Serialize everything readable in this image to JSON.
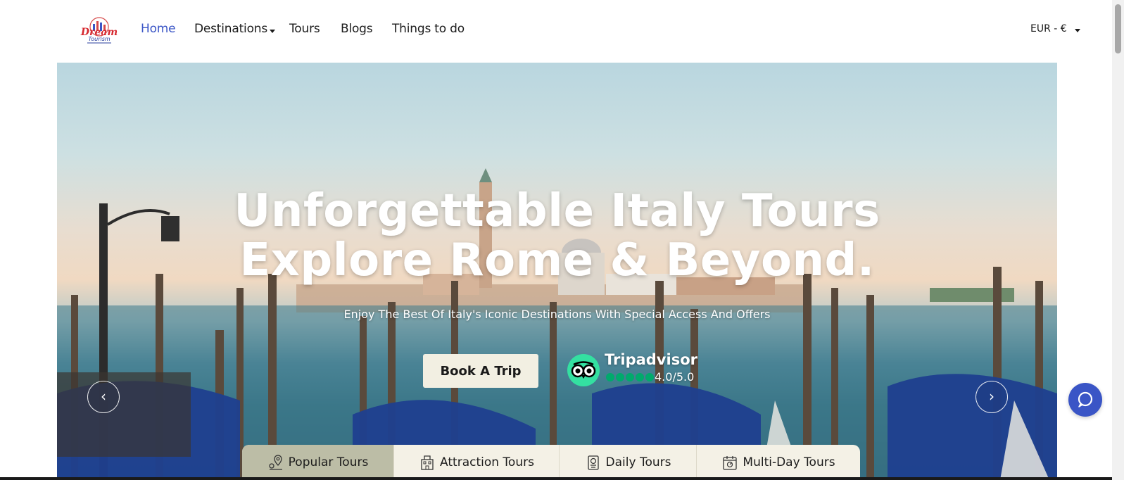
{
  "nav": {
    "logo_text": "Dream Tourism",
    "links": [
      {
        "label": "Home",
        "active": true
      },
      {
        "label": "Destinations",
        "has_dropdown": true
      },
      {
        "label": "Tours"
      },
      {
        "label": "Blogs"
      },
      {
        "label": "Things to do"
      }
    ],
    "currency": "EUR - €",
    "active_color": "#3a55c6"
  },
  "hero": {
    "headline_line1": "Unforgettable Italy Tours",
    "headline_line2": "Explore Rome & Beyond.",
    "subheadline": "Enjoy The Best Of Italy's Iconic Destinations With Special Access And Offers",
    "cta_label": "Book A Trip",
    "tripadvisor": {
      "name": "Tripadvisor",
      "rating_text": "4.0/5.0",
      "rating": 4.0,
      "max": 5,
      "brand_color": "#34e0a1"
    },
    "prev_icon": "chevron-left-icon",
    "next_icon": "chevron-right-icon",
    "prev_glyph": "‹",
    "next_glyph": "›"
  },
  "tabs": [
    {
      "label": "Popular Tours",
      "icon": "map-pin-icon",
      "active": true
    },
    {
      "label": "Attraction Tours",
      "icon": "building-icon",
      "active": false
    },
    {
      "label": "Daily Tours",
      "icon": "passport-icon",
      "active": false
    },
    {
      "label": "Multi-Day Tours",
      "icon": "calendar-icon",
      "active": false
    }
  ],
  "chat": {
    "icon": "chat-bubble-icon",
    "color": "#3a55c6"
  }
}
